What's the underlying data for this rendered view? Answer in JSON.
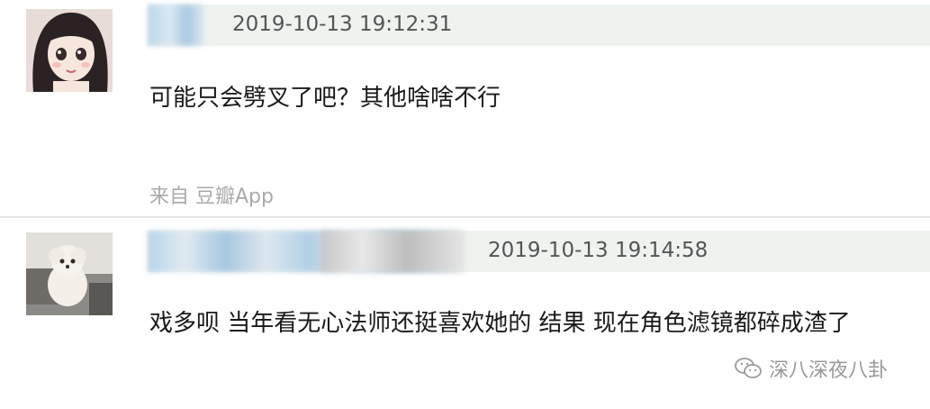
{
  "comments": [
    {
      "timestamp": "2019-10-13 19:12:31",
      "text": "可能只会劈叉了吧？其他啥啥不行",
      "source": "来自 豆瓣App",
      "avatar": "cartoon-girl-avatar"
    },
    {
      "timestamp": "2019-10-13 19:14:58",
      "text": "戏多呗 当年看无心法师还挺喜欢她的 结果 现在角色滤镜都碎成渣了",
      "avatar": "white-poodle-avatar"
    }
  ],
  "watermark": {
    "icon": "wechat-icon",
    "text": "深八深夜八卦"
  },
  "colors": {
    "meta_bar": "#eef3ef",
    "timestamp": "#555555",
    "source": "#aaaaaa",
    "comment_text": "#1a1a1a"
  }
}
